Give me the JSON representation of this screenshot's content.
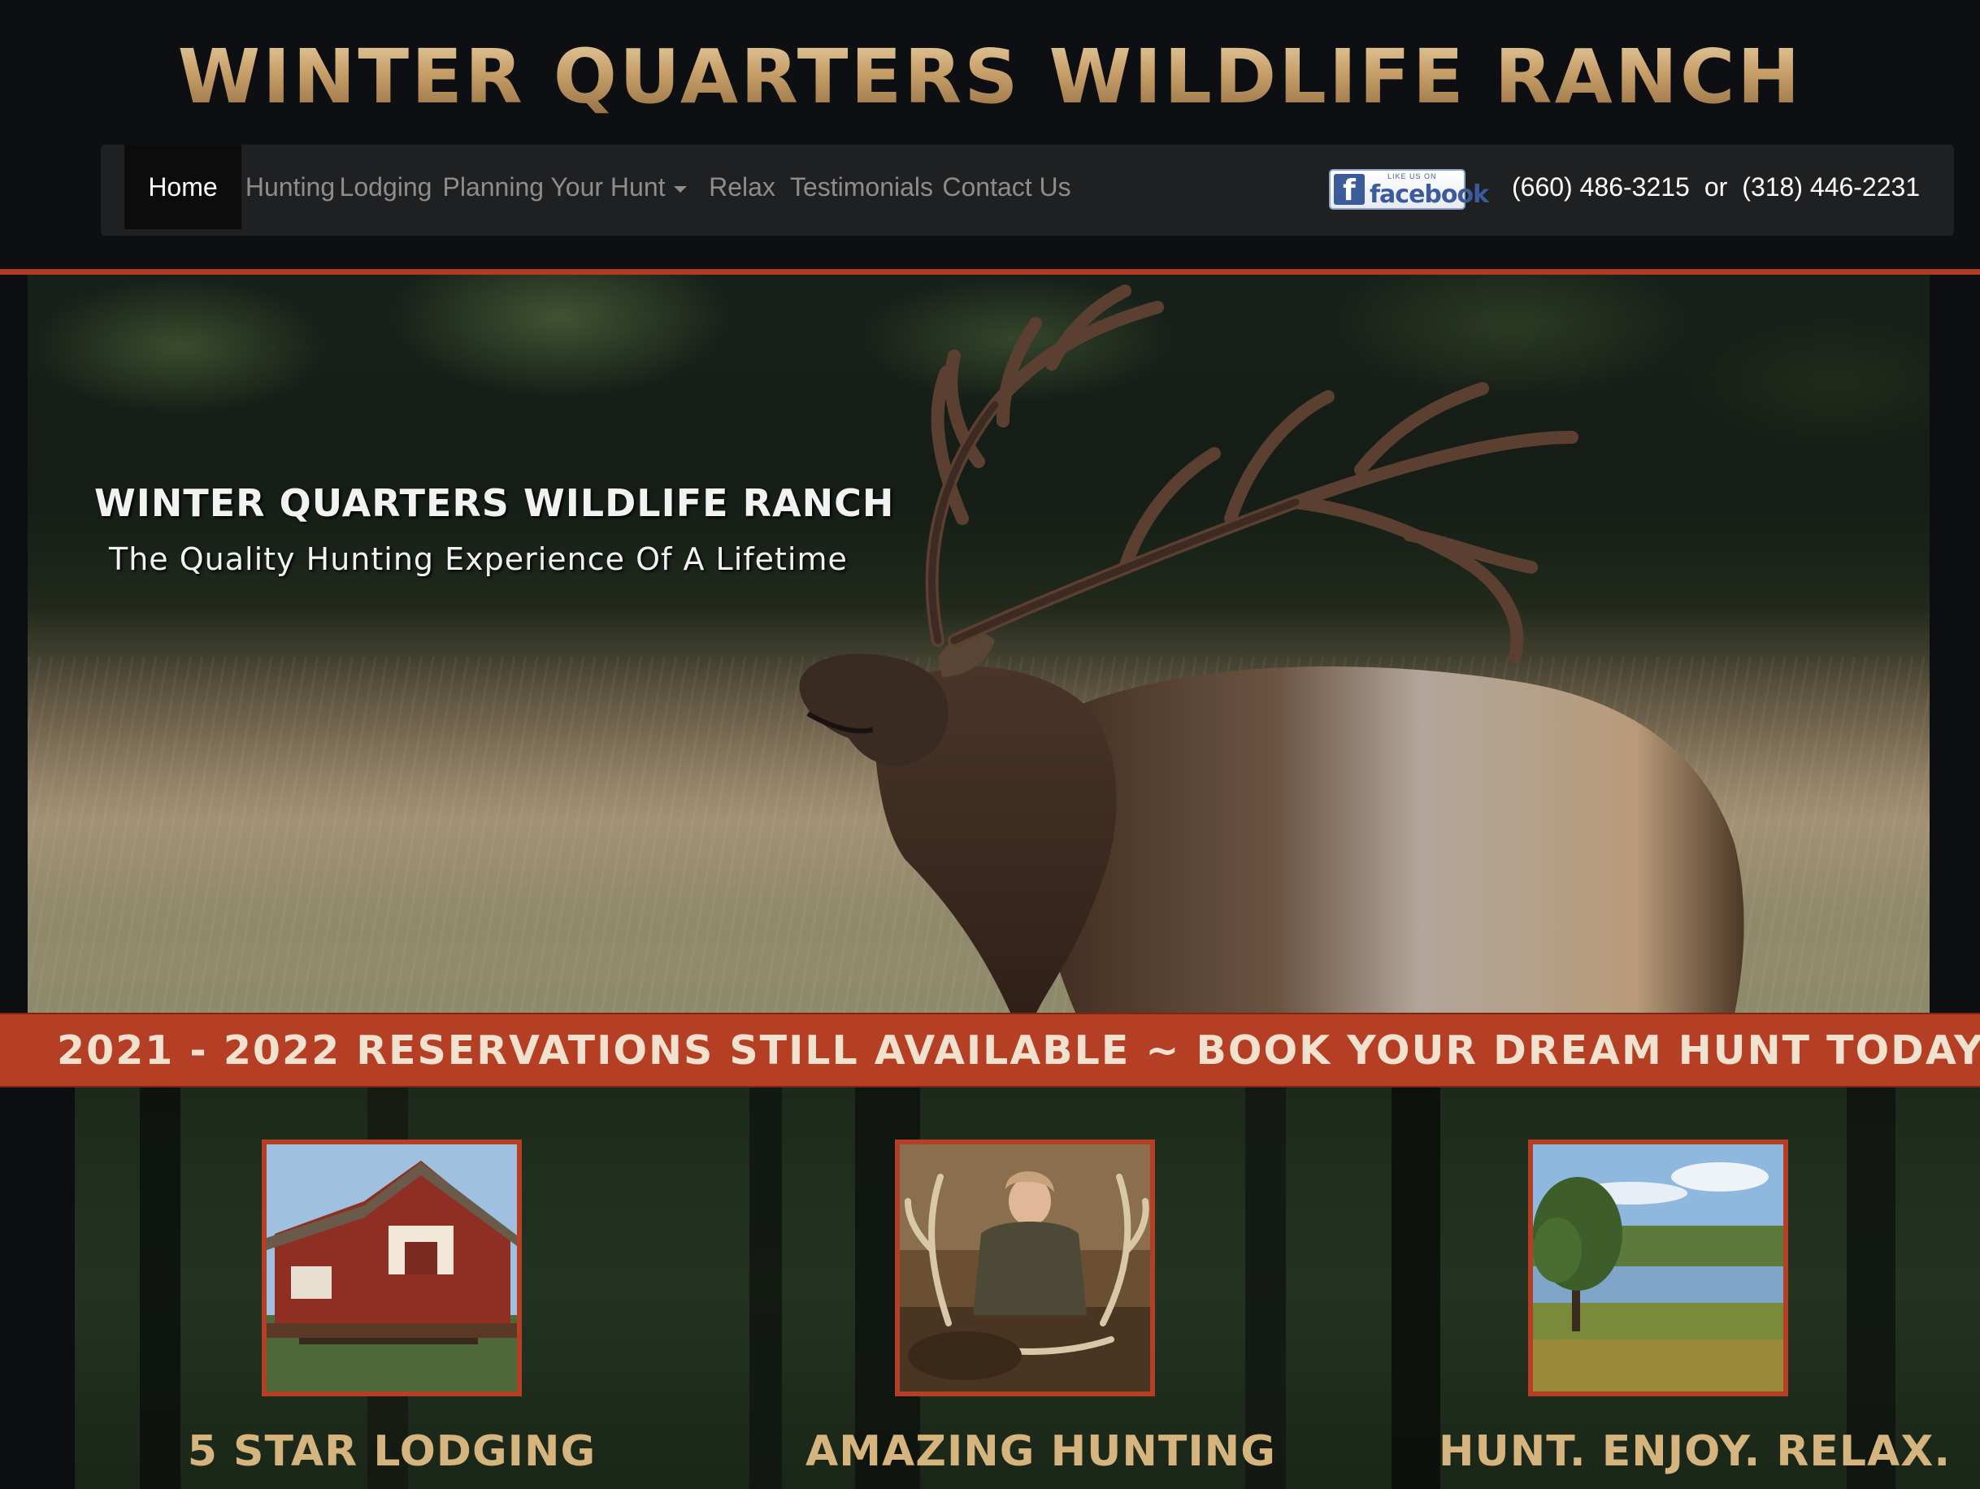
{
  "site": {
    "title": "WINTER QUARTERS WILDLIFE RANCH"
  },
  "nav": {
    "items": [
      {
        "label": "Home",
        "active": true
      },
      {
        "label": "Hunting"
      },
      {
        "label": "Lodging"
      },
      {
        "label": "Planning Your Hunt",
        "dropdown": true
      },
      {
        "label": "Relax"
      },
      {
        "label": "Testimonials"
      },
      {
        "label": "Contact Us"
      }
    ],
    "facebook": {
      "small_text": "LIKE US ON",
      "word": "facebook",
      "icon": "facebook-icon"
    },
    "phone_1": "(660) 486-3215",
    "phone_separator": "or",
    "phone_2": "(318) 446-2231"
  },
  "hero": {
    "title": "WINTER QUARTERS WILDLIFE RANCH",
    "subtitle": "The Quality Hunting Experience Of A Lifetime"
  },
  "banner": {
    "text": "2021 - 2022 RESERVATIONS STILL AVAILABLE ~ BOOK YOUR DREAM HUNT TODAY"
  },
  "features": [
    {
      "label": "5 STAR LODGING"
    },
    {
      "label": "AMAZING HUNTING"
    },
    {
      "label": "HUNT. ENJOY. RELAX."
    }
  ],
  "colors": {
    "accent_red": "#b53f24",
    "title_gold": "#c9a97a",
    "nav_bg": "#1f2022",
    "page_bg": "#0d0f12"
  }
}
